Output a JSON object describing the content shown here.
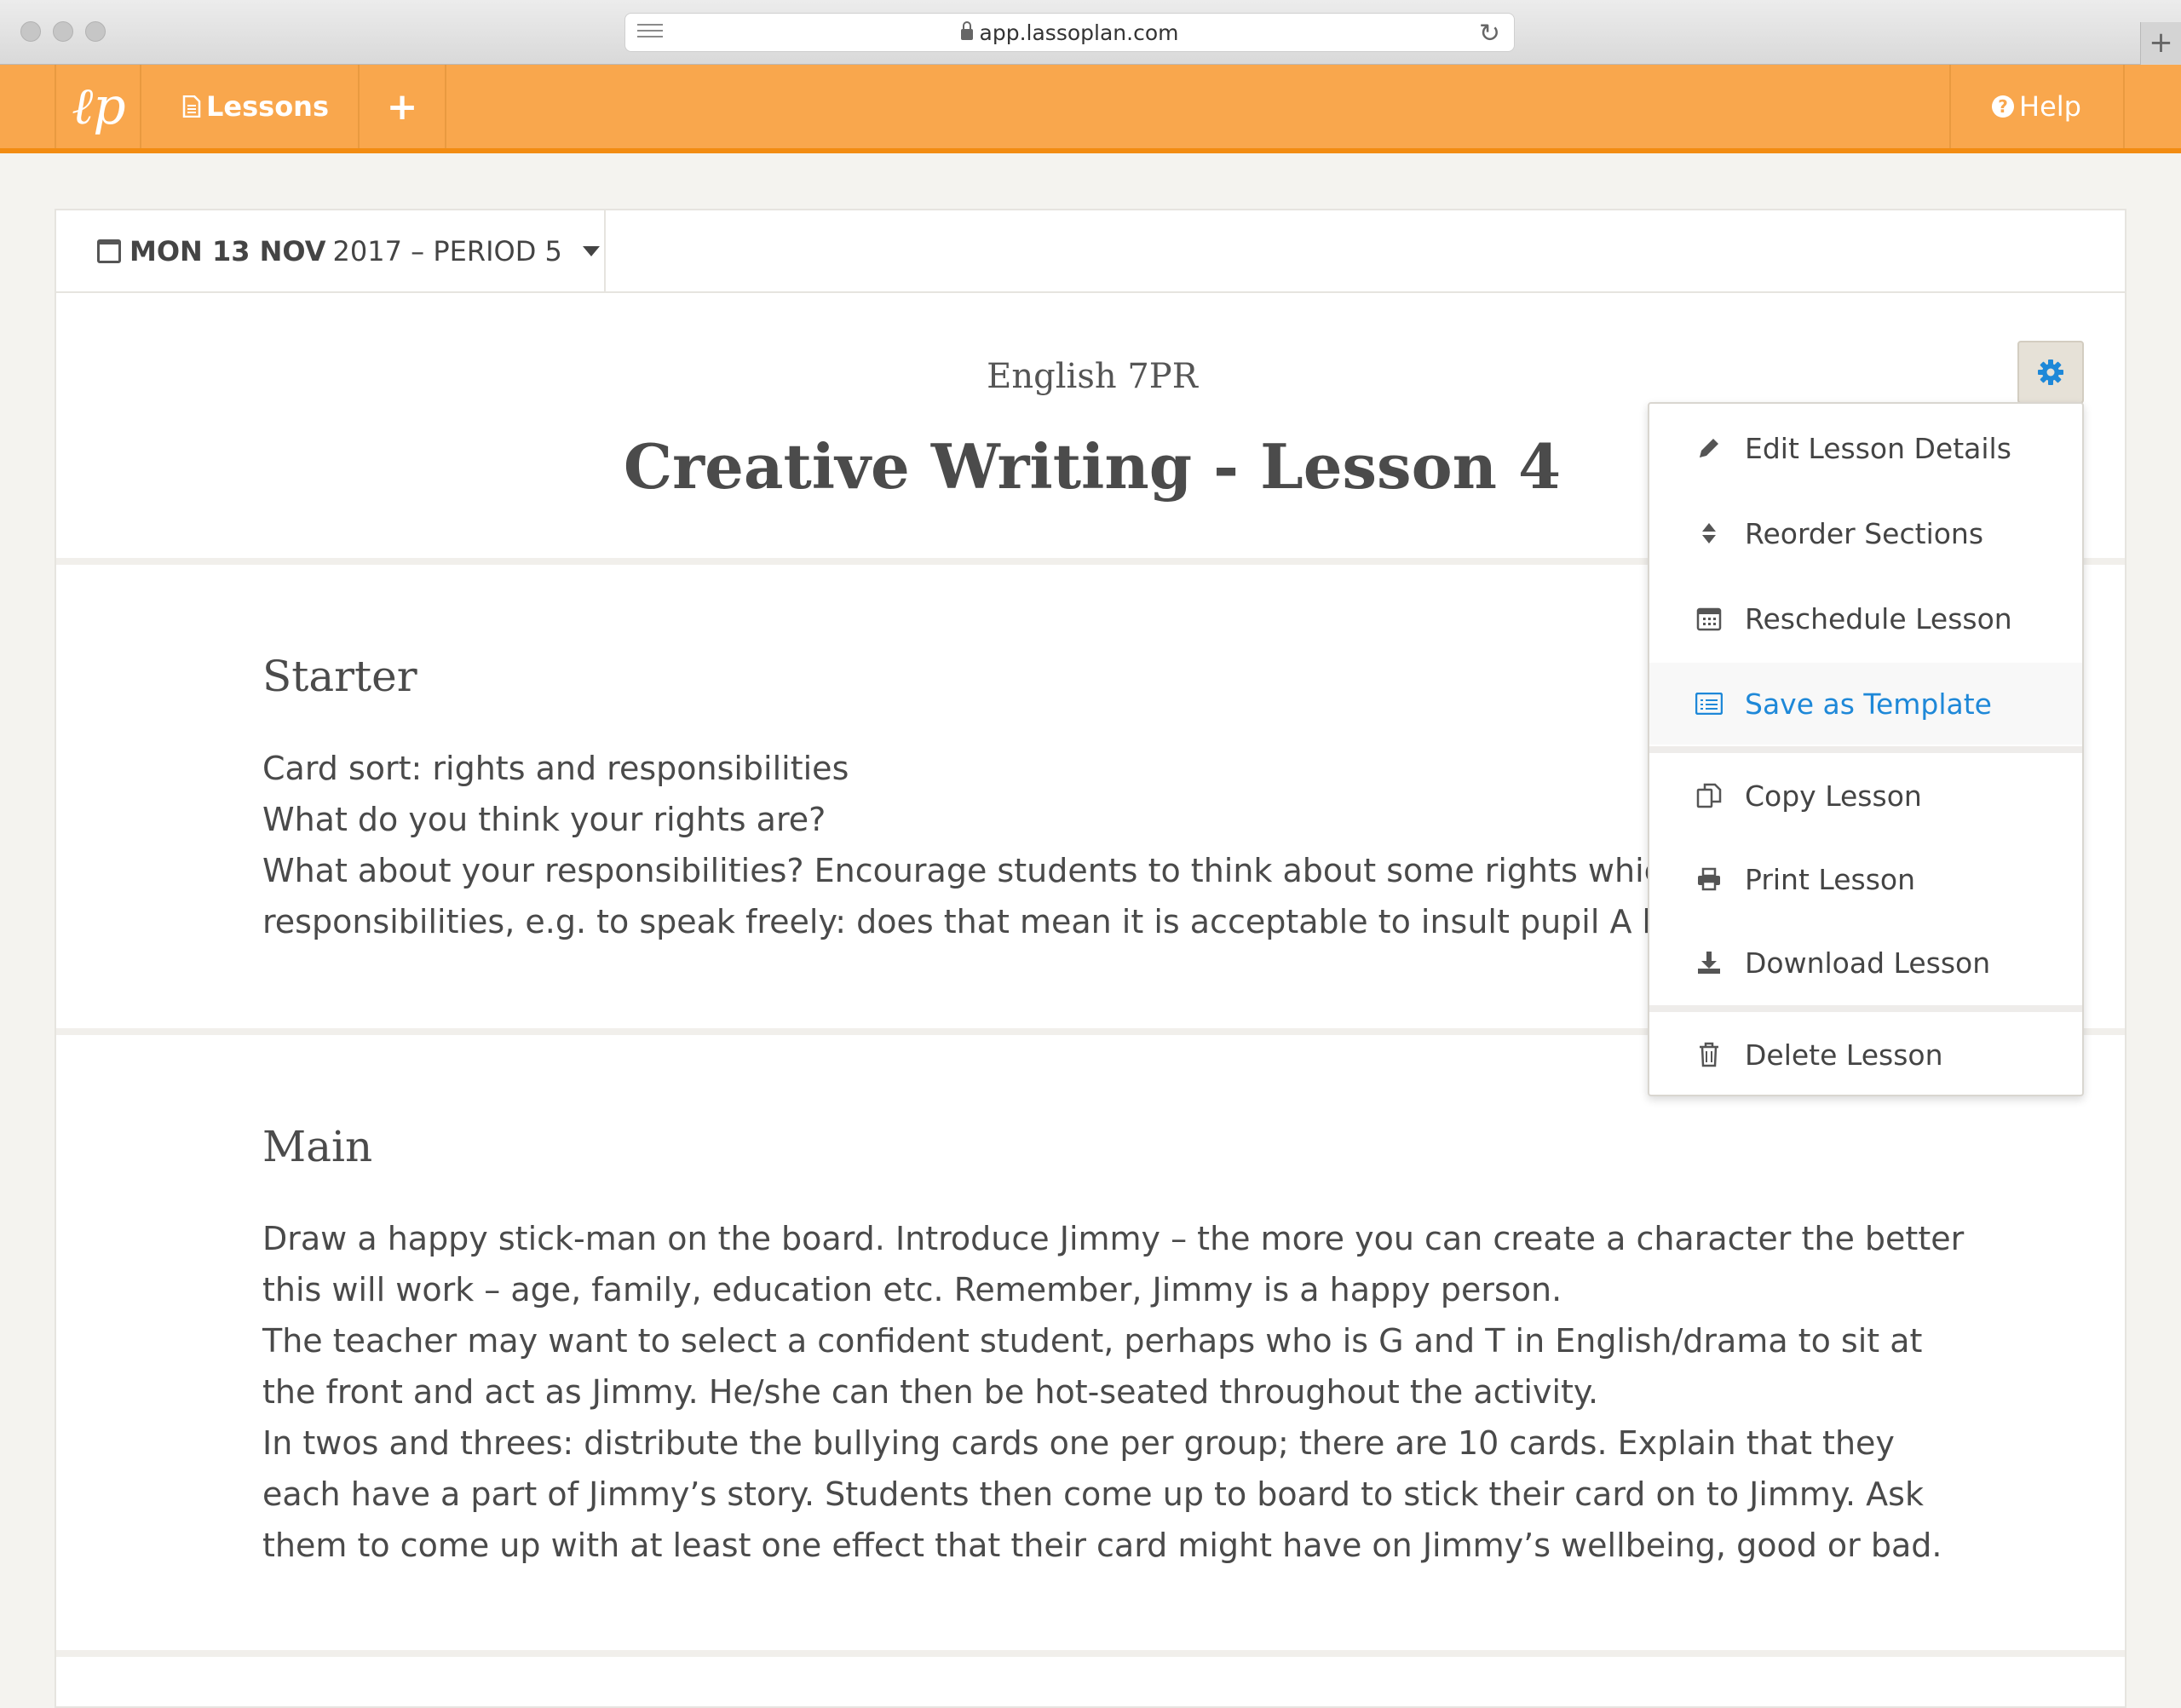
{
  "browser": {
    "url": "app.lassoplan.com"
  },
  "navbar": {
    "logo_text": "ℓp",
    "lessons_label": "Lessons",
    "add_label": "+",
    "help_label": "Help"
  },
  "lesson_header": {
    "date_bold": "MON 13 NOV",
    "date_rest": "2017 – PERIOD 5",
    "class_name": "English 7PR",
    "title": "Creative Writing - Lesson 4"
  },
  "sections": [
    {
      "title": "Starter",
      "lines": [
        "Card sort: rights and responsibilities",
        "What do you think your rights are?",
        "What about your responsibilities? Encourage students to think about some rights which",
        "responsibilities, e.g. to speak freely: does that mean it is acceptable to insult pupil A bec"
      ]
    },
    {
      "title": "Main",
      "lines": [
        "Draw a happy stick-man on the board. Introduce Jimmy – the more you can create a character the better",
        "this will work – age, family, education etc. Remember, Jimmy is a happy person.",
        "The teacher may want to select a confident student, perhaps who is G and T in English/drama to sit at",
        "the front and act as Jimmy. He/she can then be hot-seated throughout the activity.",
        "In twos and threes: distribute the bullying cards one per group; there are 10 cards. Explain that they",
        "each have a part of Jimmy’s story. Students then come up to board to stick their card on to Jimmy. Ask",
        "them to come up with at least one effect that their card might have on Jimmy’s wellbeing, good or bad."
      ]
    }
  ],
  "menu": {
    "items": [
      {
        "label": "Edit Lesson Details",
        "icon": "pencil-icon"
      },
      {
        "label": "Reorder Sections",
        "icon": "sort-icon"
      },
      {
        "label": "Reschedule Lesson",
        "icon": "calendar-icon"
      },
      {
        "label": "Save as Template",
        "icon": "template-icon"
      },
      {
        "label": "Copy Lesson",
        "icon": "copy-icon"
      },
      {
        "label": "Print Lesson",
        "icon": "print-icon"
      },
      {
        "label": "Download Lesson",
        "icon": "download-icon"
      },
      {
        "label": "Delete Lesson",
        "icon": "trash-icon"
      }
    ]
  },
  "colors": {
    "nav_orange": "#f9a74d",
    "nav_border": "#f28c12",
    "accent_blue": "#1e88d8"
  }
}
